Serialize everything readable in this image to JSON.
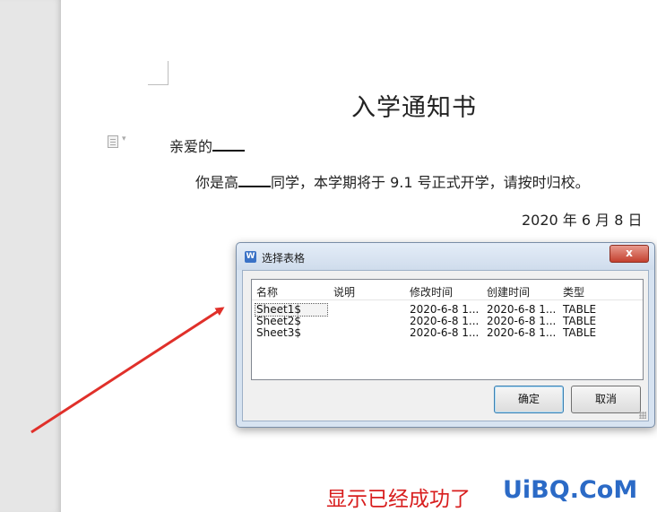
{
  "document": {
    "title": "入学通知书",
    "greeting_prefix": "亲爱的",
    "body_prefix": "你是高",
    "body_suffix": "同学，本学期将于 9.1 号正式开学，请按时归校。",
    "date": "2020 年 6 月 8 日"
  },
  "dialog": {
    "title": "选择表格",
    "close_glyph": "x",
    "columns": [
      "名称",
      "说明",
      "修改时间",
      "创建时间",
      "类型"
    ],
    "rows": [
      {
        "name": "Sheet1$",
        "desc": "",
        "modified": "2020-6-8 1...",
        "created": "2020-6-8 1...",
        "type": "TABLE"
      },
      {
        "name": "Sheet2$",
        "desc": "",
        "modified": "2020-6-8 1...",
        "created": "2020-6-8 1...",
        "type": "TABLE"
      },
      {
        "name": "Sheet3$",
        "desc": "",
        "modified": "2020-6-8 1...",
        "created": "2020-6-8 1...",
        "type": "TABLE"
      }
    ],
    "ok_label": "确定",
    "cancel_label": "取消"
  },
  "annotation": {
    "caption": "显示已经成功了",
    "watermark": "UiBQ.CoM",
    "arrow_color": "#e0302a"
  }
}
